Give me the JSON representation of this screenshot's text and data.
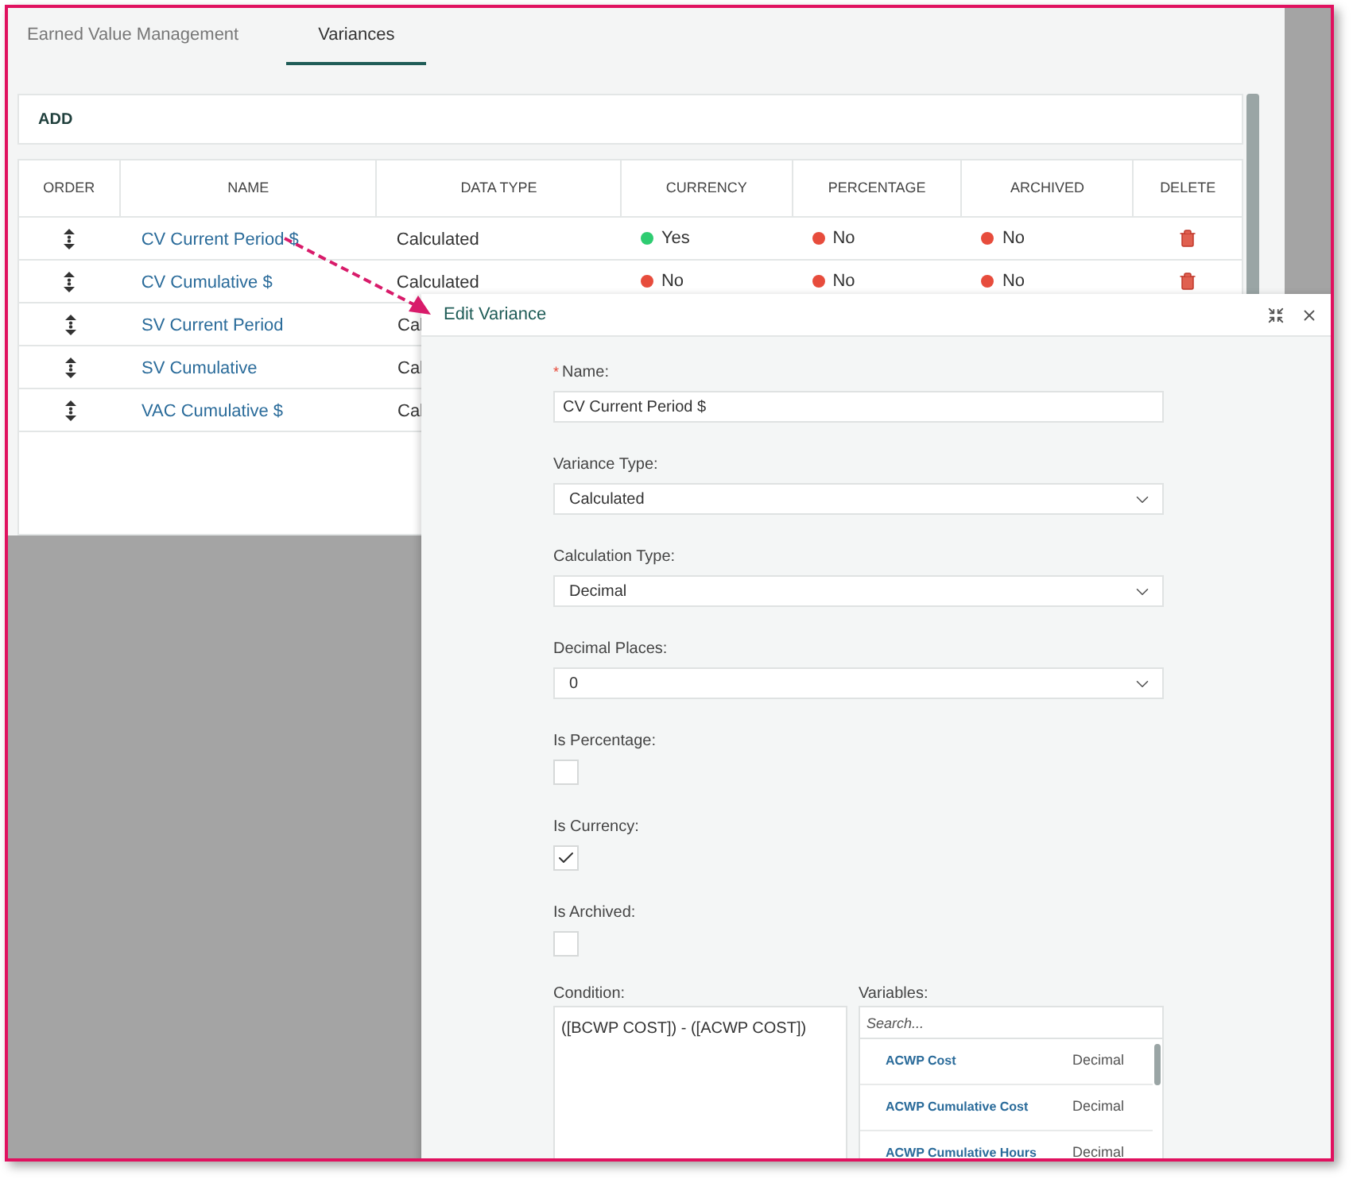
{
  "tabs": [
    {
      "label": "Earned Value Management",
      "selected": false
    },
    {
      "label": "Variances",
      "selected": true
    }
  ],
  "add_button": "ADD",
  "table": {
    "columns": [
      "ORDER",
      "NAME",
      "DATA TYPE",
      "CURRENCY",
      "PERCENTAGE",
      "ARCHIVED",
      "DELETE"
    ],
    "rows": [
      {
        "name": "CV Current Period $",
        "data_type": "Calculated",
        "flags": [
          {
            "text": "Yes",
            "color": "#2ecc71"
          },
          {
            "text": "No",
            "color": "#e74c3c"
          },
          {
            "text": "No",
            "color": "#e74c3c"
          }
        ]
      },
      {
        "name": "CV Cumulative $",
        "data_type": "Calculated",
        "flags": [
          {
            "text": "No",
            "color": "#e74c3c"
          },
          {
            "text": "No",
            "color": "#e74c3c"
          },
          {
            "text": "No",
            "color": "#e74c3c"
          }
        ]
      },
      {
        "name": "SV Current Period",
        "data_type": "Cal"
      },
      {
        "name": "SV Cumulative",
        "data_type": "Cal"
      },
      {
        "name": "VAC Cumulative $",
        "data_type": "Cal"
      }
    ]
  },
  "dialog": {
    "title": "Edit Variance",
    "fields": [
      {
        "kind": "text",
        "label": "Name:",
        "required_mark": "*",
        "value": "CV Current Period $"
      },
      {
        "kind": "select",
        "label": "Variance Type:",
        "value": "Calculated"
      },
      {
        "kind": "select",
        "label": "Calculation Type:",
        "value": "Decimal"
      },
      {
        "kind": "select",
        "label": "Decimal Places:",
        "value": "0"
      },
      {
        "kind": "checkbox",
        "label": "Is Percentage:",
        "checked": false
      },
      {
        "kind": "checkbox",
        "label": "Is Currency:",
        "checked": true
      },
      {
        "kind": "checkbox",
        "label": "Is Archived:",
        "checked": false
      }
    ],
    "condition": {
      "label": "Condition:",
      "value": "([BCWP COST]) - ([ACWP COST])"
    },
    "variables": {
      "label": "Variables:",
      "placeholder": "Search...",
      "items": [
        {
          "name": "ACWP Cost",
          "type": "Decimal"
        },
        {
          "name": "ACWP Cumulative Cost",
          "type": "Decimal"
        },
        {
          "name": "ACWP Cumulative Hours",
          "type": "Decimal"
        }
      ]
    }
  }
}
